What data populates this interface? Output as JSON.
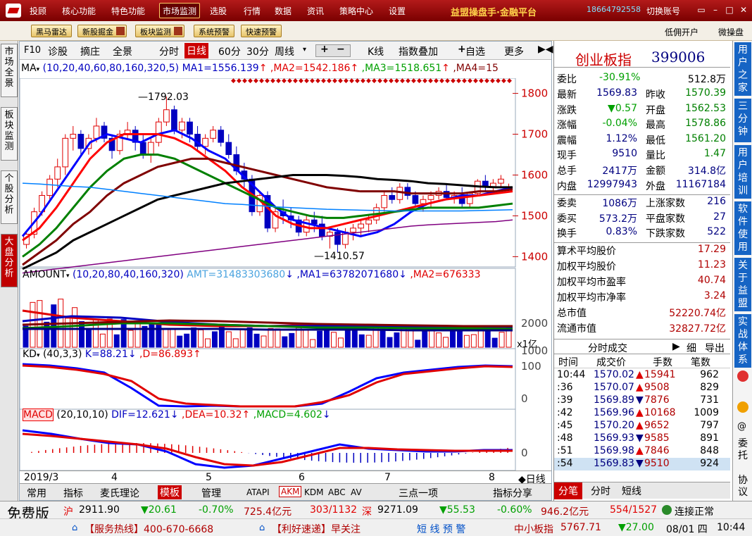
{
  "topbar": {
    "menus": [
      "投顾",
      "核心功能",
      "特色功能",
      "市场监测",
      "选股",
      "行情",
      "数据",
      "资讯",
      "策略中心",
      "设置"
    ],
    "active_menu": "市场监测",
    "brand": "益盟操盘手·金融平台",
    "phone": "18664792558",
    "switch_account": "切换账号"
  },
  "toolbar": {
    "buttons": [
      "黑马雷达",
      "新股掘金",
      "板块监测",
      "系统预警",
      "快速预警"
    ],
    "right_links": [
      "低佣开户",
      "微操盘"
    ]
  },
  "left_tabs": [
    "市场全景",
    "板块监测",
    "个股分析",
    "大盘分析"
  ],
  "chart_toolbar": {
    "items": [
      "F10",
      "诊股",
      "摘庄",
      "全景"
    ],
    "periods": [
      "分时",
      "日线",
      "60分",
      "30分",
      "周线"
    ],
    "active_period": "日线",
    "right": [
      "K线",
      "指数叠加",
      "自选",
      "更多"
    ],
    "plus": "+",
    "minus": "−"
  },
  "ma_legend": {
    "name": "MA",
    "params": "(10,20,40,60,80,160,320,5)",
    "ma1": "MA1=1556.139",
    "ma2": ",MA2=1542.186",
    "ma3": ",MA3=1518.651",
    "ma4": ",MA4=15"
  },
  "price_axis": [
    "1800",
    "1700",
    "1600",
    "1500",
    "1400"
  ],
  "price_annotations": {
    "high": "1792.03",
    "low": "1410.57"
  },
  "amount_legend": {
    "name": "AMOUNT",
    "params": "(10,20,80,40,160,320)",
    "amt": "AMT=31483303680",
    "ma1": ",MA1=63782071680",
    "ma2": ",MA2=676333"
  },
  "amount_axis": [
    "2000",
    "1000"
  ],
  "amount_unit": "x1亿",
  "kd_legend": {
    "name": "KD",
    "params": "(40,3,3)",
    "k": "K=88.21",
    "d": ",D=86.893"
  },
  "kd_axis": [
    "100",
    "0"
  ],
  "macd_legend": {
    "name": "MACD",
    "params": "(20,10,10)",
    "dif": "DIF=12.621",
    "dea": ",DEA=10.32",
    "macd": ",MACD=4.602"
  },
  "macd_axis": [
    "0"
  ],
  "date_axis": [
    "2019/3",
    "4",
    "5",
    "6",
    "7",
    "8"
  ],
  "date_axis_label": "日线",
  "bottom_tabs": [
    "常用",
    "指标",
    "麦氏理论",
    "模板",
    "管理"
  ],
  "bottom_codes": [
    "ATAPI",
    "AKM",
    "KDM",
    "ABC",
    "AV"
  ],
  "bottom_center": "三点一项",
  "bottom_share": "指标分享",
  "index": {
    "name": "创业板指",
    "code": "399006"
  },
  "quote": {
    "weibi_label": "委比",
    "weibi": "-30.91%",
    "weicha": "512.8万",
    "rows": [
      [
        "最新",
        "1569.83",
        "昨收",
        "1570.39"
      ],
      [
        "涨跌",
        "▼0.57",
        "开盘",
        "1562.53"
      ],
      [
        "涨幅",
        "-0.04%",
        "最高",
        "1578.86"
      ],
      [
        "震幅",
        "1.12%",
        "最低",
        "1561.20"
      ],
      [
        "现手",
        "9510",
        "量比",
        "1.47"
      ],
      [
        "总手",
        "2417万",
        "金额",
        "314.8亿"
      ],
      [
        "内盘",
        "12997943",
        "外盘",
        "11167184"
      ]
    ],
    "rows2": [
      [
        "委卖",
        "1086万",
        "上涨家数",
        "216"
      ],
      [
        "委买",
        "573.2万",
        "平盘家数",
        "27"
      ],
      [
        "换手",
        "0.83%",
        "下跌家数",
        "522"
      ]
    ],
    "stats": [
      [
        "算术平均股价",
        "17.29"
      ],
      [
        "加权平均股价",
        "11.23"
      ],
      [
        "加权平均市盈率",
        "40.74"
      ],
      [
        "加权平均市净率",
        "3.24"
      ],
      [
        "总市值",
        "52220.74亿"
      ],
      [
        "流通市值",
        "32827.72亿"
      ]
    ]
  },
  "trades_header": {
    "title": "分时成交",
    "btn1": "细",
    "btn2": "导出"
  },
  "trades_cols": [
    "时间",
    "成交价",
    "手数",
    "笔数"
  ],
  "trades": [
    [
      "10:44",
      "1570.02",
      "▲",
      "15941",
      "962"
    ],
    [
      ":36",
      "1570.07",
      "▲",
      "9508",
      "829"
    ],
    [
      ":39",
      "1569.89",
      "▼",
      "7876",
      "731"
    ],
    [
      ":42",
      "1569.96",
      "▲",
      "10168",
      "1009"
    ],
    [
      ":45",
      "1570.20",
      "▲",
      "9652",
      "797"
    ],
    [
      ":48",
      "1569.93",
      "▼",
      "9585",
      "891"
    ],
    [
      ":51",
      "1569.98",
      "▲",
      "7846",
      "848"
    ],
    [
      ":54",
      "1569.83",
      "▼",
      "9510",
      "924"
    ]
  ],
  "rp_bottom_tabs": [
    "分笔",
    "分时",
    "短线"
  ],
  "right_tabs": [
    "用户之家",
    "三分钟",
    "用户培训",
    "软件使用",
    "关于益盟",
    "实战体系"
  ],
  "right_small": [
    "委托",
    "协议"
  ],
  "status": {
    "free": "免费版",
    "sh_label": "沪",
    "sh_val": "2911.90",
    "sh_chg": "▼20.61",
    "sh_pct": "-0.70%",
    "sh_amt": "725.4亿元",
    "sh_ratio": "303/1132",
    "sz_label": "深",
    "sz_val": "9271.09",
    "sz_chg": "▼55.53",
    "sz_pct": "-0.60%",
    "sz_amt": "946.2亿元",
    "sz_ratio": "554/1527",
    "conn": "连接正常",
    "hotline": "【服务热线】400-670-6668",
    "news": "【利好速递】早关注",
    "alert": "短 线 预 警",
    "sme_label": "中小板指",
    "sme_val": "5767.71",
    "sme_chg": "▼27.00",
    "date": "08/01 四",
    "time": "10:44"
  },
  "chart_data": {
    "type": "candlestick",
    "price_axis": {
      "min": 1380,
      "max": 1820,
      "ticks": [
        1400,
        1500,
        1600,
        1700,
        1800
      ]
    },
    "months": [
      "2019/3",
      "4",
      "5",
      "6",
      "7",
      "8"
    ],
    "candles": [
      [
        1430,
        1460,
        1420,
        1455
      ],
      [
        1455,
        1520,
        1445,
        1510
      ],
      [
        1510,
        1560,
        1500,
        1550
      ],
      [
        1550,
        1600,
        1540,
        1590
      ],
      [
        1590,
        1640,
        1570,
        1620
      ],
      [
        1620,
        1700,
        1600,
        1690
      ],
      [
        1690,
        1720,
        1660,
        1700
      ],
      [
        1700,
        1710,
        1650,
        1665
      ],
      [
        1665,
        1700,
        1650,
        1690
      ],
      [
        1690,
        1740,
        1680,
        1720
      ],
      [
        1720,
        1730,
        1680,
        1690
      ],
      [
        1690,
        1700,
        1640,
        1660
      ],
      [
        1660,
        1710,
        1650,
        1700
      ],
      [
        1700,
        1730,
        1690,
        1710
      ],
      [
        1710,
        1720,
        1660,
        1680
      ],
      [
        1680,
        1700,
        1640,
        1650
      ],
      [
        1650,
        1690,
        1630,
        1680
      ],
      [
        1680,
        1740,
        1670,
        1730
      ],
      [
        1730,
        1792,
        1720,
        1760
      ],
      [
        1760,
        1770,
        1700,
        1710
      ],
      [
        1710,
        1740,
        1690,
        1730
      ],
      [
        1730,
        1740,
        1680,
        1700
      ],
      [
        1700,
        1720,
        1660,
        1670
      ],
      [
        1670,
        1700,
        1650,
        1690
      ],
      [
        1690,
        1720,
        1680,
        1710
      ],
      [
        1710,
        1720,
        1670,
        1680
      ],
      [
        1680,
        1700,
        1640,
        1650
      ],
      [
        1650,
        1670,
        1600,
        1610
      ],
      [
        1610,
        1630,
        1570,
        1590
      ],
      [
        1590,
        1600,
        1500,
        1510
      ],
      [
        1510,
        1560,
        1500,
        1550
      ],
      [
        1550,
        1560,
        1460,
        1470
      ],
      [
        1470,
        1520,
        1460,
        1510
      ],
      [
        1510,
        1540,
        1480,
        1500
      ],
      [
        1500,
        1520,
        1470,
        1490
      ],
      [
        1490,
        1500,
        1450,
        1460
      ],
      [
        1460,
        1500,
        1450,
        1490
      ],
      [
        1490,
        1510,
        1460,
        1480
      ],
      [
        1480,
        1500,
        1440,
        1450
      ],
      [
        1450,
        1470,
        1420,
        1460
      ],
      [
        1460,
        1470,
        1411,
        1430
      ],
      [
        1430,
        1470,
        1420,
        1460
      ],
      [
        1460,
        1480,
        1440,
        1470
      ],
      [
        1470,
        1490,
        1450,
        1480
      ],
      [
        1480,
        1500,
        1460,
        1490
      ],
      [
        1490,
        1530,
        1480,
        1520
      ],
      [
        1520,
        1560,
        1510,
        1550
      ],
      [
        1550,
        1570,
        1530,
        1540
      ],
      [
        1540,
        1580,
        1530,
        1570
      ],
      [
        1570,
        1580,
        1540,
        1550
      ],
      [
        1550,
        1560,
        1520,
        1530
      ],
      [
        1530,
        1550,
        1510,
        1540
      ],
      [
        1540,
        1560,
        1520,
        1550
      ],
      [
        1550,
        1570,
        1540,
        1560
      ],
      [
        1560,
        1580,
        1540,
        1545
      ],
      [
        1545,
        1560,
        1530,
        1550
      ],
      [
        1550,
        1570,
        1520,
        1530
      ],
      [
        1530,
        1560,
        1520,
        1555
      ],
      [
        1555,
        1590,
        1550,
        1585
      ],
      [
        1585,
        1600,
        1560,
        1570
      ],
      [
        1570,
        1590,
        1560,
        1580
      ],
      [
        1580,
        1600,
        1570,
        1590
      ],
      [
        1570,
        1579,
        1561,
        1570
      ]
    ],
    "ma_series": [
      {
        "name": "MA1",
        "color": "#0000ff",
        "values": [
          1450,
          1500,
          1560,
          1620,
          1680,
          1700,
          1690,
          1680,
          1700,
          1710,
          1690,
          1660,
          1640,
          1600,
          1560,
          1520,
          1490,
          1480,
          1470,
          1460,
          1450,
          1460,
          1480,
          1510,
          1530,
          1540,
          1550,
          1550,
          1560,
          1570
        ]
      },
      {
        "name": "MA2",
        "color": "#ff0000",
        "values": [
          1440,
          1470,
          1520,
          1580,
          1640,
          1680,
          1700,
          1700,
          1700,
          1690,
          1670,
          1640,
          1610,
          1570,
          1540,
          1500,
          1480,
          1470,
          1470,
          1480,
          1490,
          1500,
          1510,
          1520,
          1530,
          1540,
          1545,
          1550,
          1555,
          1560
        ]
      },
      {
        "name": "MA3",
        "color": "#008000",
        "values": [
          1400,
          1430,
          1470,
          1520,
          1570,
          1610,
          1640,
          1650,
          1650,
          1640,
          1620,
          1600,
          1580,
          1560,
          1540,
          1520,
          1510,
          1500,
          1495,
          1495,
          1500,
          1505,
          1510,
          1515,
          1520,
          1520,
          1520,
          1520,
          1525,
          1530
        ]
      },
      {
        "name": "MA4",
        "color": "#800000",
        "values": [
          1380,
          1410,
          1440,
          1480,
          1510,
          1550,
          1580,
          1600,
          1620,
          1630,
          1640,
          1640,
          1630,
          1620,
          1610,
          1600,
          1590,
          1580,
          1570,
          1565,
          1560,
          1560,
          1560,
          1555,
          1555,
          1555,
          1555,
          1560,
          1560,
          1565
        ]
      },
      {
        "name": "MA5",
        "color": "#000000",
        "values": [
          1370,
          1390,
          1410,
          1440,
          1460,
          1480,
          1500,
          1520,
          1540,
          1550,
          1560,
          1570,
          1580,
          1585,
          1590,
          1595,
          1600,
          1600,
          1600,
          1598,
          1595,
          1590,
          1588,
          1585,
          1580,
          1578,
          1575,
          1572,
          1570,
          1570
        ]
      },
      {
        "name": "MA6",
        "color": "#0080ff",
        "values": [
          1580,
          1578,
          1575,
          1572,
          1570,
          1565,
          1560,
          1555,
          1550,
          1545,
          1540,
          1535,
          1530,
          1528,
          1525,
          1522,
          1520,
          1518,
          1516,
          1515,
          1514,
          1513,
          1512,
          1512,
          1512,
          1512,
          1512,
          1513,
          1514,
          1515
        ]
      },
      {
        "name": "MA7",
        "color": "#800080",
        "values": [
          1360,
          1365,
          1370,
          1375,
          1380,
          1385,
          1390,
          1395,
          1400,
          1405,
          1410,
          1415,
          1420,
          1425,
          1430,
          1435,
          1440,
          1445,
          1450,
          1455,
          1460,
          1465,
          1470,
          1475,
          1478,
          1480,
          1482,
          1484,
          1486,
          1490
        ]
      }
    ]
  }
}
